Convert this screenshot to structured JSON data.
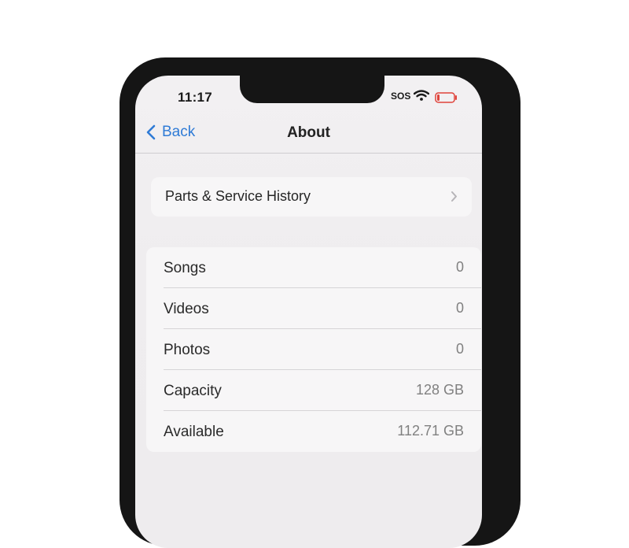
{
  "status_bar": {
    "time": "11:17",
    "carrier": "SOS"
  },
  "nav": {
    "back_label": "Back",
    "title": "About"
  },
  "service_row": {
    "label": "Parts & Service History"
  },
  "info_rows": [
    {
      "label": "Songs",
      "value": "0"
    },
    {
      "label": "Videos",
      "value": "0"
    },
    {
      "label": "Photos",
      "value": "0"
    },
    {
      "label": "Capacity",
      "value": "128 GB"
    },
    {
      "label": "Available",
      "value": "112.71 GB"
    }
  ],
  "colors": {
    "accent": "#2f7bd6",
    "battery_low": "#e0433b"
  },
  "icons": [
    "chevron-left-icon",
    "wifi-icon",
    "battery-icon",
    "chevron-right-icon"
  ]
}
